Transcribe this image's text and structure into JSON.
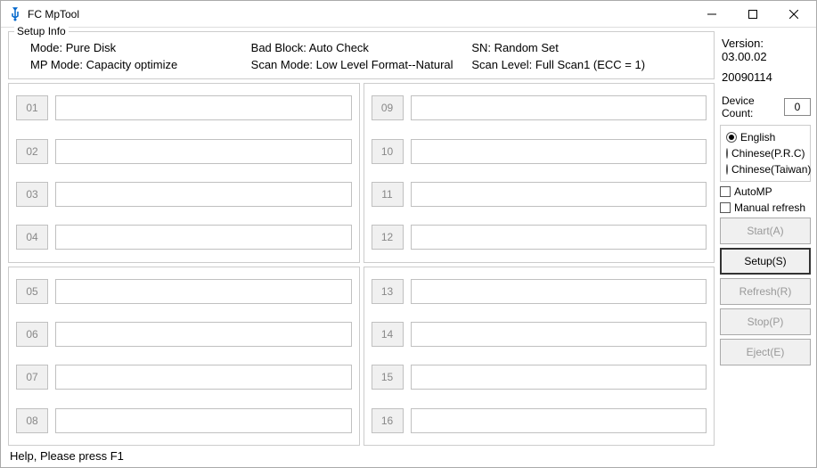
{
  "window": {
    "title": "FC MpTool"
  },
  "setup": {
    "legend": "Setup Info",
    "mode_label": "Mode:",
    "mode_value": "Pure Disk",
    "bad_block_label": "Bad Block:",
    "bad_block_value": "Auto Check",
    "sn_label": "SN:",
    "sn_value": "Random Set",
    "mp_mode_label": "MP Mode:",
    "mp_mode_value": "Capacity optimize",
    "scan_mode_label": "Scan Mode:",
    "scan_mode_value": "Low Level Format--Natural",
    "scan_level_label": "Scan Level:",
    "scan_level_value": "Full Scan1 (ECC = 1)"
  },
  "slots": {
    "g1": [
      "01",
      "02",
      "03",
      "04"
    ],
    "g2": [
      "09",
      "10",
      "11",
      "12"
    ],
    "g3": [
      "05",
      "06",
      "07",
      "08"
    ],
    "g4": [
      "13",
      "14",
      "15",
      "16"
    ]
  },
  "side": {
    "version_label": "Version:",
    "version_value": "03.00.02",
    "date": "20090114",
    "device_count_label": "Device Count:",
    "device_count_value": "0",
    "lang": {
      "english": "English",
      "chinese_prc": "Chinese(P.R.C)",
      "chinese_tw": "Chinese(Taiwan)",
      "selected": "english"
    },
    "auto_mp": "AutoMP",
    "manual_refresh": "Manual refresh",
    "buttons": {
      "start": "Start(A)",
      "setup": "Setup(S)",
      "refresh": "Refresh(R)",
      "stop": "Stop(P)",
      "eject": "Eject(E)"
    }
  },
  "status": "Help, Please press F1"
}
